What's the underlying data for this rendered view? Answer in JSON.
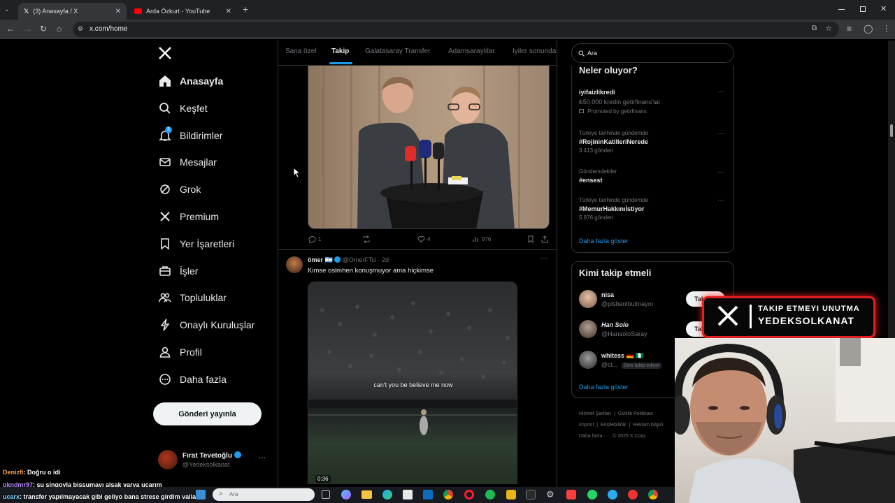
{
  "browser": {
    "tabs": [
      {
        "title": "(3) Anasayfa / X",
        "active": true
      },
      {
        "title": "Arda Özkurt - YouTube",
        "active": false
      }
    ],
    "url": "x.com/home",
    "new_tab": "+",
    "close": "✕"
  },
  "nav": {
    "items": [
      {
        "label": "Anasayfa",
        "icon": "home-icon"
      },
      {
        "label": "Keşfet",
        "icon": "search-icon"
      },
      {
        "label": "Bildirimler",
        "icon": "bell-icon",
        "badge": "3"
      },
      {
        "label": "Mesajlar",
        "icon": "mail-icon"
      },
      {
        "label": "Grok",
        "icon": "grok-icon"
      },
      {
        "label": "Premium",
        "icon": "x-logo-icon"
      },
      {
        "label": "Yer İşaretleri",
        "icon": "bookmark-icon"
      },
      {
        "label": "İşler",
        "icon": "briefcase-icon"
      },
      {
        "label": "Topluluklar",
        "icon": "people-icon"
      },
      {
        "label": "Onaylı Kuruluşlar",
        "icon": "bolt-icon"
      },
      {
        "label": "Profil",
        "icon": "person-icon"
      },
      {
        "label": "Daha fazla",
        "icon": "more-circle-icon"
      }
    ],
    "post_button": "Gönderi yayınla",
    "account": {
      "name": "Fırat Tevetoğlu",
      "handle": "@Yedeksolkanat",
      "more": "···"
    }
  },
  "feed": {
    "tabs": [
      "Sana özel",
      "Takip",
      "Galatasaray Transfer",
      "Adamsaraylılar",
      "İyiler sonunda"
    ],
    "active_tab": "Takip",
    "post1": {
      "replies": "1",
      "likes": "4",
      "views": "976"
    },
    "post2": {
      "author": "ömer",
      "flag": "🇦🇷",
      "handle": "@OmerFTci",
      "time": "· 2d",
      "text": "Kimse oslmhen konuşmuyor ama hiçkimse",
      "caption": "can't you be believe me now",
      "duration": "0:36"
    }
  },
  "sidebar": {
    "search_value": "Ara",
    "trends_title": "Neler oluyor?",
    "promo": {
      "name": "iyifaizlikredi",
      "text": "₺50.000 kredin getirfinans'tal",
      "sponsor": "Promoted by getirfinans"
    },
    "trends": [
      {
        "category": "Türkiye tarihinde gündemde",
        "title": "#RojininKatilleriNerede",
        "count": "3.413 gönderi"
      },
      {
        "category": "Gündemdekiler",
        "title": "#ensest",
        "count": ""
      },
      {
        "category": "Türkiye tarihinde gündemde",
        "title": "#MemurHakkınıİstiyor",
        "count": "5.876 gönderi"
      }
    ],
    "show_more": "Daha fazla göster",
    "who_title": "Kimi takip etmeli",
    "who": [
      {
        "name": "nisa",
        "handle": "@plsbenlbulmayın",
        "button": "Takip et"
      },
      {
        "name": "Han Solo",
        "handle": "@HansoloSaray",
        "button": "Takip et"
      },
      {
        "name": "whitess 🇩🇪 🇳🇬",
        "handle": "@ci...",
        "tag": "Seni takip ediyor"
      }
    ],
    "footer": [
      "Hizmet Şartları",
      "Gizlilik Politikası",
      "Imprint",
      "Erişilebilirlik",
      "Reklam bilgisi",
      "Daha fazla ···",
      "© 2025 X Corp."
    ]
  },
  "overlay": {
    "banner_line1": "TAKIP ETMEYI UNUTMA",
    "banner_line2": "YEDEKSOLKANAT",
    "chat": [
      {
        "user": "Denizfi",
        "msg": ": Doğru o idi"
      },
      {
        "user": "gkndmr97",
        "msg": ": şu singoyla bissumayı alsak varya uçarım"
      },
      {
        "user": "ucarx",
        "msg": ": transfer yapılmayacak gibi geliyo bana strese girdim valla"
      }
    ],
    "taskbar_search": "Ara"
  }
}
